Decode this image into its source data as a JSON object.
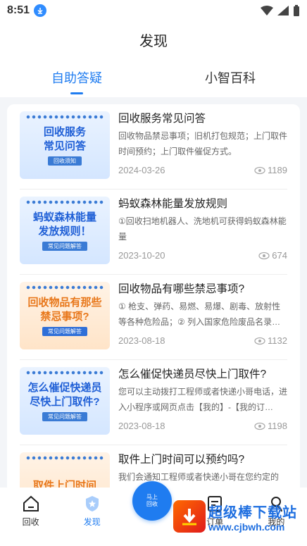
{
  "status": {
    "time": "8:51"
  },
  "header": {
    "title": "发现"
  },
  "tabs": [
    {
      "label": "自助答疑",
      "active": true
    },
    {
      "label": "小智百科",
      "active": false
    }
  ],
  "articles": [
    {
      "thumb_text": "回收服务\n常见问答",
      "thumb_tag": "回收须知",
      "thumb_style": "blue",
      "title": "回收服务常见问答",
      "desc": "回收物品禁忌事项；旧机打包规范；上门取件时间预约；上门取件催促方式。",
      "date": "2024-03-26",
      "views": "1189"
    },
    {
      "thumb_text": "蚂蚁森林能量\n发放规则！",
      "thumb_tag": "常见问题解答",
      "thumb_style": "blue",
      "title": "蚂蚁森林能量发放规则",
      "desc": "①回收扫地机器人、洗地机可获得蚂蚁森林能量",
      "date": "2023-10-20",
      "views": "674"
    },
    {
      "thumb_text": "回收物品有那些\n禁忌事项?",
      "thumb_tag": "常见问题解答",
      "thumb_style": "orange",
      "title": "回收物品有哪些禁忌事项?",
      "desc": "① 枪支、弹药、易燃、易爆、剧毒、放射性等各种危险品；② 列入国家危险废品名录…",
      "date": "2023-08-18",
      "views": "1132"
    },
    {
      "thumb_text": "怎么催促快递员\n尽快上门取件?",
      "thumb_tag": "常见问题解答",
      "thumb_style": "blue",
      "title": "怎么催促快递员尽快上门取件?",
      "desc": "您可以主动拨打工程师或者快递小哥电话，进入小程序或网页点击【我的】-【我的订…",
      "date": "2023-08-18",
      "views": "1198"
    },
    {
      "thumb_text": "取件上门时间",
      "thumb_tag": "",
      "thumb_style": "orange",
      "title": "取件上门时间可以预约吗?",
      "desc": "我们会通知工程师或者快递小哥在您约定的",
      "date": "",
      "views": ""
    }
  ],
  "bottom_nav": [
    {
      "label": "回收",
      "icon": "home-icon",
      "active": false
    },
    {
      "label": "发现",
      "icon": "discover-icon",
      "active": true
    },
    {
      "label": "订单",
      "icon": "order-icon",
      "active": false
    },
    {
      "label": "我的",
      "icon": "profile-icon",
      "active": false
    }
  ],
  "fab": {
    "label": "马上\n回收"
  },
  "watermark": {
    "name": "超级棒下载站",
    "url": "www.cjbwh.com"
  },
  "colors": {
    "accent": "#1f7cf0",
    "background": "#f3f5f8"
  }
}
